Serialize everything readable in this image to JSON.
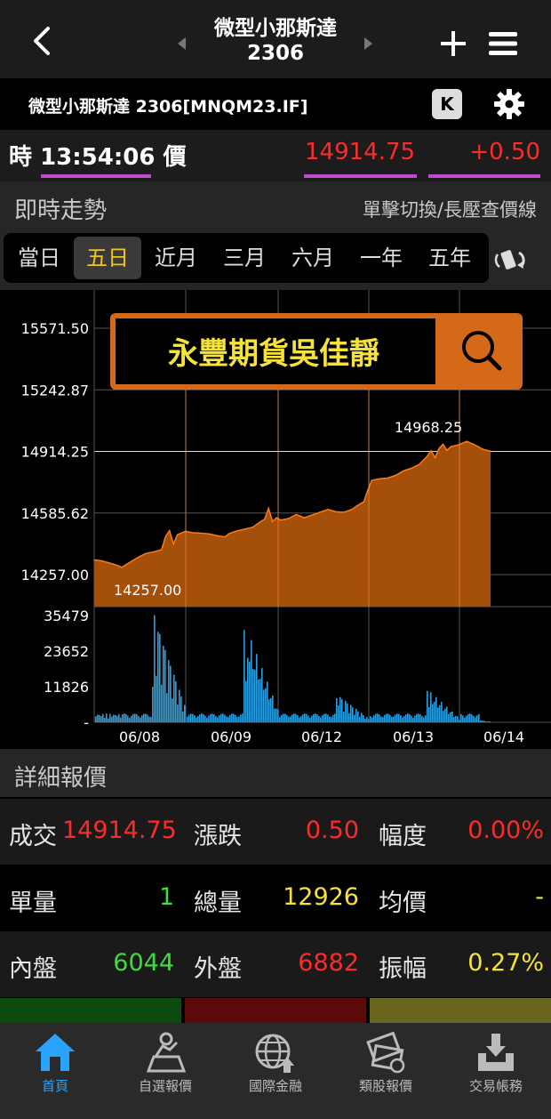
{
  "header": {
    "title_name": "微型小那斯達",
    "title_code": "2306",
    "symbol_line": "微型小那斯達 2306[MNQM23.IF]",
    "k_label": "K"
  },
  "quote_bar": {
    "time_prefix": "時",
    "time": "13:54:06",
    "price_label": "價",
    "price": "14914.75",
    "change": "+0.50"
  },
  "trend": {
    "title": "即時走勢",
    "hint": "單擊切換/長壓查價線",
    "periods": [
      "當日",
      "五日",
      "近月",
      "三月",
      "六月",
      "一年",
      "五年"
    ],
    "active_period": "五日"
  },
  "watermark": {
    "text": "永豐期貨吳佳靜"
  },
  "chart_data": {
    "type": "area",
    "price_axis": {
      "ticks": [
        "15571.50",
        "15242.87",
        "14914.25",
        "14585.62",
        "14257.00"
      ],
      "ylim": [
        14257.0,
        15571.5
      ]
    },
    "high_label": "14968.25",
    "low_label": "14257.00",
    "x_labels": [
      "06/08",
      "06/09",
      "06/12",
      "06/13",
      "06/14"
    ],
    "price_series": [
      [
        0,
        14336
      ],
      [
        0.02,
        14330
      ],
      [
        0.04,
        14318
      ],
      [
        0.06,
        14305
      ],
      [
        0.07,
        14296
      ],
      [
        0.09,
        14323
      ],
      [
        0.11,
        14348
      ],
      [
        0.13,
        14370
      ],
      [
        0.15,
        14378
      ],
      [
        0.17,
        14390
      ],
      [
        0.18,
        14460
      ],
      [
        0.19,
        14492
      ],
      [
        0.2,
        14420
      ],
      [
        0.21,
        14470
      ],
      [
        0.23,
        14488
      ],
      [
        0.25,
        14480
      ],
      [
        0.27,
        14478
      ],
      [
        0.29,
        14474
      ],
      [
        0.31,
        14465
      ],
      [
        0.33,
        14458
      ],
      [
        0.34,
        14476
      ],
      [
        0.36,
        14490
      ],
      [
        0.38,
        14500
      ],
      [
        0.4,
        14510
      ],
      [
        0.42,
        14540
      ],
      [
        0.43,
        14552
      ],
      [
        0.44,
        14610
      ],
      [
        0.45,
        14540
      ],
      [
        0.46,
        14560
      ],
      [
        0.47,
        14548
      ],
      [
        0.49,
        14556
      ],
      [
        0.51,
        14578
      ],
      [
        0.53,
        14560
      ],
      [
        0.55,
        14575
      ],
      [
        0.57,
        14590
      ],
      [
        0.59,
        14605
      ],
      [
        0.61,
        14592
      ],
      [
        0.63,
        14590
      ],
      [
        0.65,
        14605
      ],
      [
        0.66,
        14620
      ],
      [
        0.68,
        14645
      ],
      [
        0.69,
        14705
      ],
      [
        0.7,
        14760
      ],
      [
        0.72,
        14768
      ],
      [
        0.74,
        14772
      ],
      [
        0.76,
        14786
      ],
      [
        0.78,
        14810
      ],
      [
        0.8,
        14824
      ],
      [
        0.82,
        14845
      ],
      [
        0.84,
        14888
      ],
      [
        0.85,
        14918
      ],
      [
        0.86,
        14880
      ],
      [
        0.87,
        14930
      ],
      [
        0.88,
        14952
      ],
      [
        0.89,
        14920
      ],
      [
        0.9,
        14940
      ],
      [
        0.92,
        14950
      ],
      [
        0.94,
        14968
      ],
      [
        0.96,
        14950
      ],
      [
        0.98,
        14926
      ],
      [
        1.0,
        14914.75
      ]
    ],
    "volume_axis": {
      "ticks": [
        "35479",
        "23652",
        "11826",
        "-"
      ],
      "ylim": [
        0,
        35479
      ]
    },
    "grid": true
  },
  "detail": {
    "title": "詳細報價",
    "rows": [
      [
        {
          "label": "成交",
          "value": "14914.75",
          "color": "#ff2a2a"
        },
        {
          "label": "漲跌",
          "value": "0.50",
          "color": "#ff2a2a"
        },
        {
          "label": "幅度",
          "value": "0.00%",
          "color": "#ff2a2a"
        }
      ],
      [
        {
          "label": "單量",
          "value": "1",
          "color": "#3fdc3f"
        },
        {
          "label": "總量",
          "value": "12926",
          "color": "#f5e23a"
        },
        {
          "label": "均價",
          "value": "-",
          "color": "#f5e23a"
        }
      ],
      [
        {
          "label": "內盤",
          "value": "6044",
          "color": "#3fdc3f"
        },
        {
          "label": "外盤",
          "value": "6882",
          "color": "#ff2a2a"
        },
        {
          "label": "振幅",
          "value": "0.27%",
          "color": "#f5e23a"
        }
      ]
    ]
  },
  "nav": {
    "items": [
      {
        "label": "首頁",
        "icon": "home-icon",
        "active": true
      },
      {
        "label": "自選報價",
        "icon": "watchlist-icon",
        "active": false
      },
      {
        "label": "國際金融",
        "icon": "globe-icon",
        "active": false
      },
      {
        "label": "類股報價",
        "icon": "sector-icon",
        "active": false
      },
      {
        "label": "交易帳務",
        "icon": "trade-icon",
        "active": false
      }
    ]
  },
  "colors": {
    "up": "#ff2a2a",
    "down": "#3fdc3f",
    "flat": "#f5e23a",
    "accent": "#c24bd1",
    "chart_fill": "#a44f0a",
    "chart_line": "#ff7a1a",
    "volume": "#2b9fe0",
    "nav_active": "#2aa3ff"
  }
}
